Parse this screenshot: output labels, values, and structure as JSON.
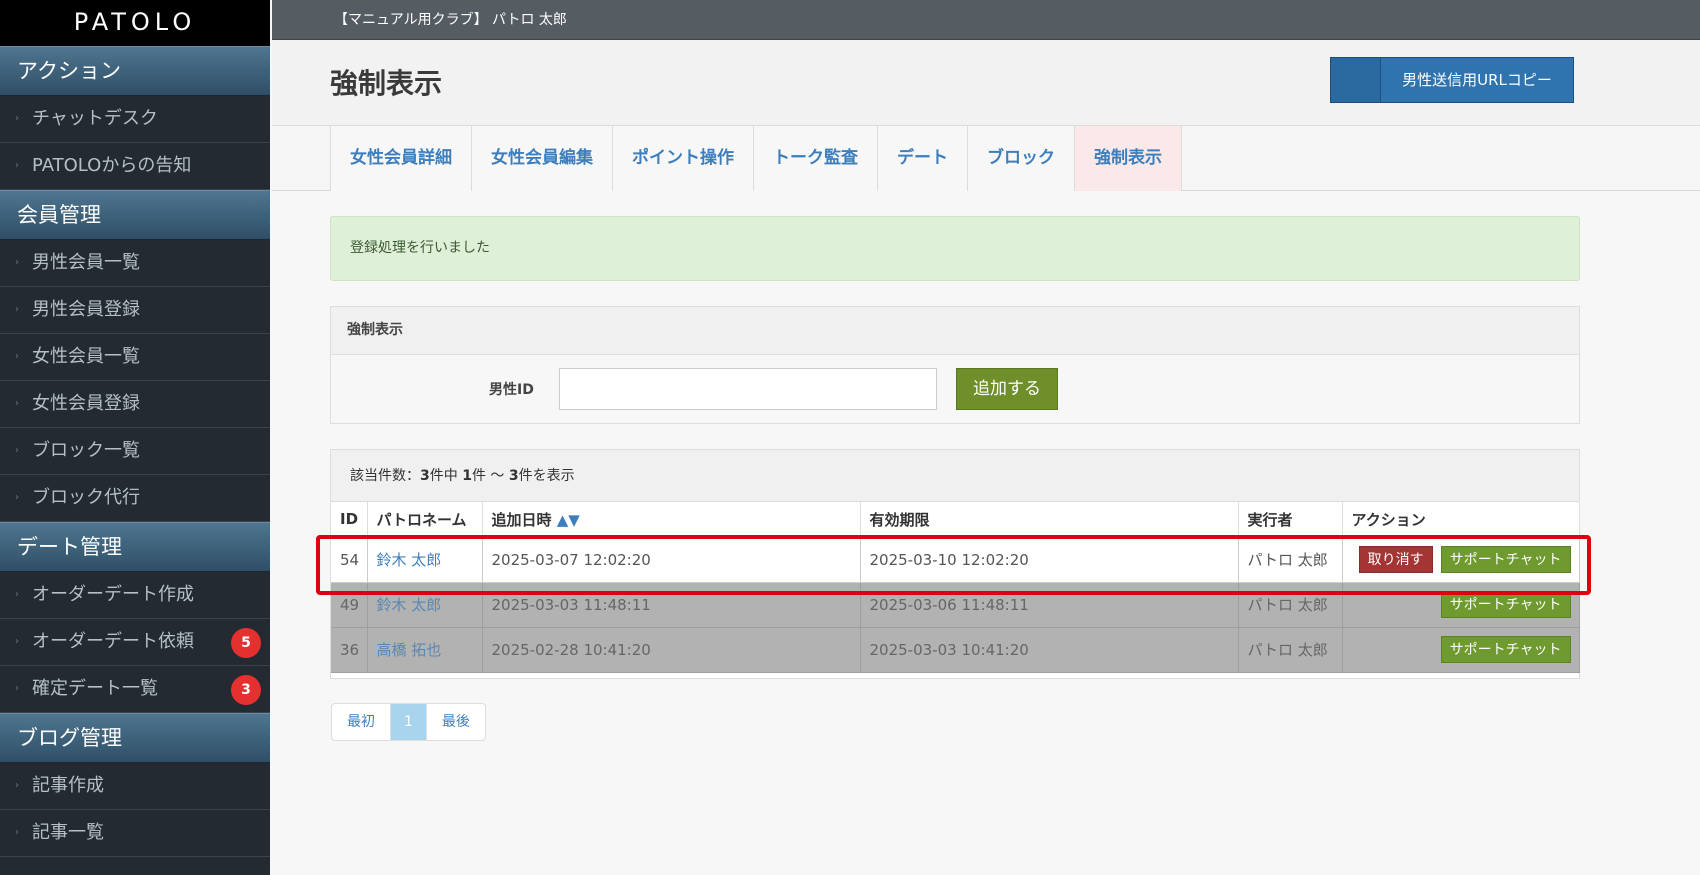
{
  "sidebar": {
    "logo": "PATOLO",
    "sections": [
      {
        "title": "アクション",
        "items": [
          {
            "label": "チャットデスク"
          },
          {
            "label": "PATOLOからの告知"
          }
        ]
      },
      {
        "title": "会員管理",
        "items": [
          {
            "label": "男性会員一覧"
          },
          {
            "label": "男性会員登録"
          },
          {
            "label": "女性会員一覧"
          },
          {
            "label": "女性会員登録"
          },
          {
            "label": "ブロック一覧"
          },
          {
            "label": "ブロック代行"
          }
        ]
      },
      {
        "title": "デート管理",
        "items": [
          {
            "label": "オーダーデート作成"
          },
          {
            "label": "オーダーデート依頼",
            "badge": "5"
          },
          {
            "label": "確定デート一覧",
            "badge": "3"
          }
        ]
      },
      {
        "title": "ブログ管理",
        "items": [
          {
            "label": "記事作成"
          },
          {
            "label": "記事一覧"
          }
        ]
      }
    ]
  },
  "topbar": {
    "user": "【マニュアル用クラブ】 パトロ 太郎"
  },
  "header": {
    "title": "強制表示",
    "copy_button": "男性送信用URLコピー"
  },
  "tabs": [
    "女性会員詳細",
    "女性会員編集",
    "ポイント操作",
    "トーク監査",
    "デート",
    "ブロック",
    "強制表示"
  ],
  "alert": {
    "message": "登録処理を行いました"
  },
  "form": {
    "heading": "強制表示",
    "field_label": "男性ID",
    "field_value": "",
    "submit": "追加する"
  },
  "list": {
    "count_prefix": "該当件数：",
    "count_total": "3",
    "count_mid1": "件中 ",
    "count_from": "1",
    "count_mid2": "件 ～ ",
    "count_to": "3",
    "count_suffix": "件を表示",
    "headers": {
      "id": "ID",
      "name": "パトロネーム",
      "added": "追加日時",
      "sort_arrows": "▲▼",
      "expires": "有効期限",
      "executor": "実行者",
      "action": "アクション"
    },
    "cancel_label": "取り消す",
    "chat_label": "サポートチャット",
    "rows": [
      {
        "id": "54",
        "name": "鈴木 太郎",
        "added": "2025-03-07 12:02:20",
        "expires": "2025-03-10 12:02:20",
        "executor": "パトロ 太郎"
      },
      {
        "id": "49",
        "name": "鈴木 太郎",
        "added": "2025-03-03 11:48:11",
        "expires": "2025-03-06 11:48:11",
        "executor": "パトロ 太郎"
      },
      {
        "id": "36",
        "name": "高橋 拓也",
        "added": "2025-02-28 10:41:20",
        "expires": "2025-03-03 10:41:20",
        "executor": "パトロ 太郎"
      }
    ]
  },
  "pagination": {
    "first": "最初",
    "current": "1",
    "last": "最後"
  },
  "colors": {
    "highlight": "#e00010",
    "accent": "#3d7fbd",
    "success_bg": "#dff0d8"
  }
}
